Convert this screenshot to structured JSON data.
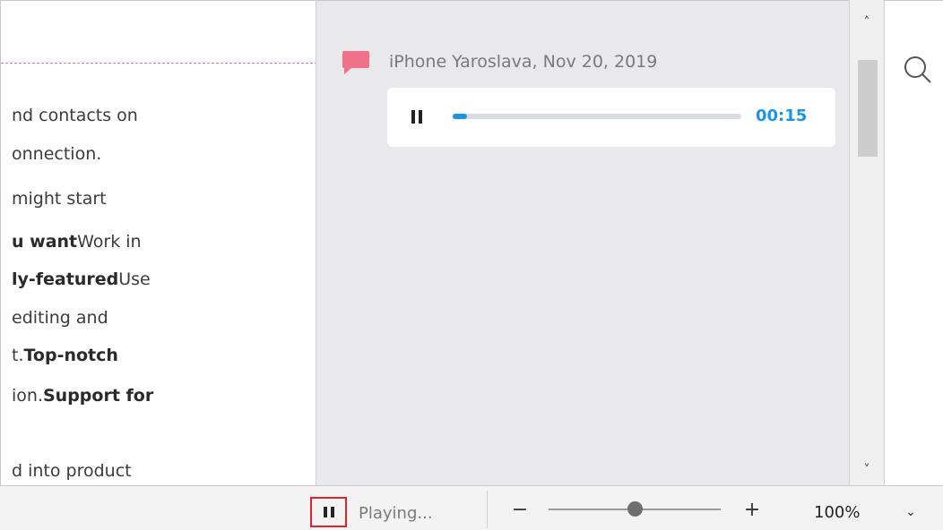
{
  "document": {
    "lines": [
      {
        "plain": "nd contacts on",
        "bold": "",
        "tail": ""
      },
      {
        "plain": "onnection.",
        "bold": "",
        "tail": ""
      },
      {
        "plain": "might start",
        "bold": "",
        "tail": ""
      },
      {
        "plain": "",
        "bold": "u want",
        "tail": "Work in"
      },
      {
        "plain": "",
        "bold": "ly-featured",
        "tail": "Use"
      },
      {
        "plain": "editing and",
        "bold": "",
        "tail": ""
      },
      {
        "plain": "t.",
        "bold": "Top-notch",
        "tail": ""
      },
      {
        "plain": "ion.",
        "bold": "Support for",
        "tail": ""
      },
      {
        "plain": "d into product",
        "bold": "",
        "tail": ""
      }
    ]
  },
  "comment": {
    "author_date": "iPhone Yaroslava, Nov 20, 2019",
    "marker_color": "#f07288",
    "audio": {
      "state_icon": "pause-icon",
      "progress": 0.05,
      "time": "00:15",
      "accent": "#1d95e6"
    }
  },
  "scrollbar": {
    "up_glyph": "˄",
    "down_glyph": "˅"
  },
  "search": {
    "icon": "search-icon"
  },
  "statusbar": {
    "play_state_icon": "pause-icon",
    "status_text": "Playing...",
    "zoom_minus": "−",
    "zoom_plus": "+",
    "zoom_level": "100%",
    "zoom_fraction": 0.47,
    "dropdown_glyph": "⌄",
    "highlight_color": "#e0252a"
  }
}
